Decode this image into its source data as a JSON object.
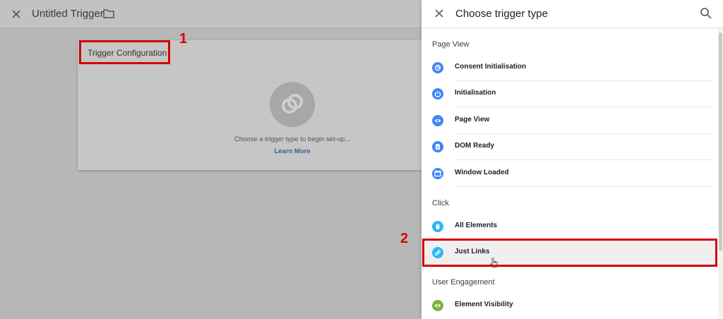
{
  "editor": {
    "title": "Untitled Trigger",
    "card_title": "Trigger Configuration",
    "hint": "Choose a trigger type to begin set-up...",
    "learn_more": "Learn More"
  },
  "annotations": {
    "first": "1",
    "second": "2"
  },
  "panel": {
    "title": "Choose trigger type",
    "sections": [
      {
        "label": "Page View",
        "items": [
          {
            "label": "Consent Initialisation",
            "icon": "consent-icon",
            "color": "#4285f4"
          },
          {
            "label": "Initialisation",
            "icon": "power-icon",
            "color": "#4285f4"
          },
          {
            "label": "Page View",
            "icon": "eye-icon",
            "color": "#4285f4"
          },
          {
            "label": "DOM Ready",
            "icon": "document-icon",
            "color": "#4285f4"
          },
          {
            "label": "Window Loaded",
            "icon": "window-icon",
            "color": "#4285f4"
          }
        ]
      },
      {
        "label": "Click",
        "items": [
          {
            "label": "All Elements",
            "icon": "mouse-icon",
            "color": "#29b6f6"
          },
          {
            "label": "Just Links",
            "icon": "link-icon",
            "color": "#29b6f6"
          }
        ]
      },
      {
        "label": "User Engagement",
        "items": [
          {
            "label": "Element Visibility",
            "icon": "visibility-icon",
            "color": "#7cb342"
          }
        ]
      }
    ]
  },
  "colors": {
    "annotation_red": "#d40000",
    "link_blue": "#3a5f94"
  }
}
